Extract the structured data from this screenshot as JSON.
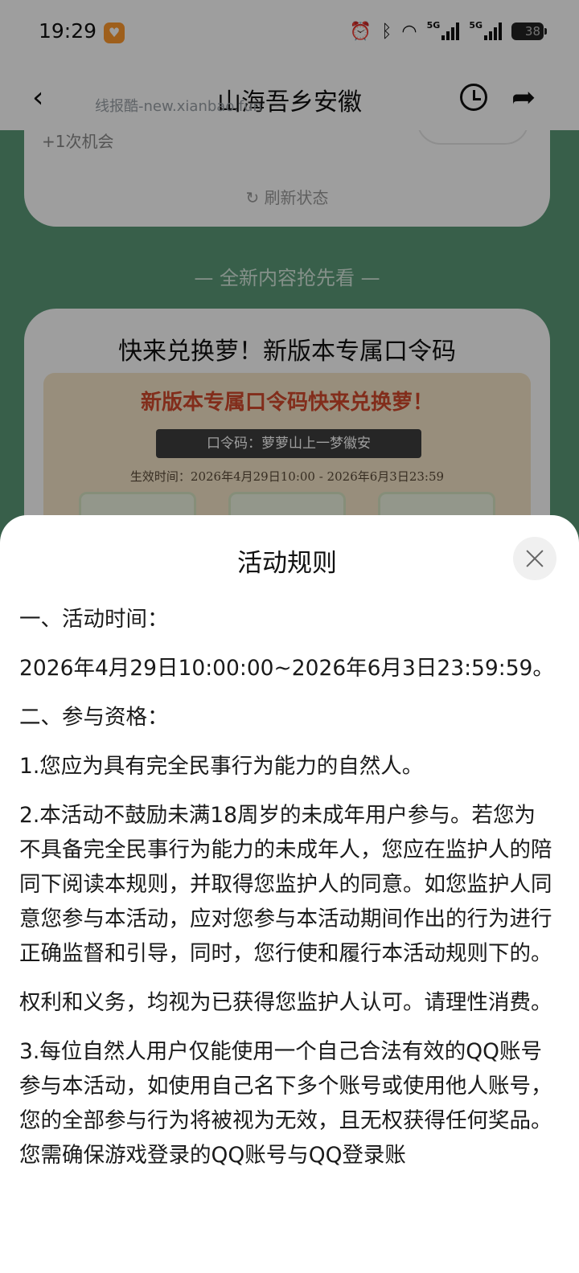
{
  "status_bar": {
    "time": "19:29",
    "app_badge_icon": "app-notification-icon",
    "network_type_1": "5G",
    "network_type_2": "5G",
    "battery_level": "38"
  },
  "nav": {
    "title": "山海吾乡安徽",
    "watermark": "线报酷-new.xianbao.fun"
  },
  "chance_card": {
    "chance_text": "+1次机会",
    "refresh_label": "刷新状态"
  },
  "section": {
    "divider_label": "— 全新内容抢先看 —"
  },
  "promo_card": {
    "title": "快来兑换萝！新版本专属口令码",
    "banner_title": "新版本专属口令码快来兑换萝！",
    "banner_code": "口令码：萝萝山上一梦徽安",
    "banner_time": "生效时间：2026年4月29日10:00 - 2026年6月3日23:59"
  },
  "rules_sheet": {
    "title": "活动规则",
    "paragraphs": [
      "一、活动时间：",
      "2026年4月29日10:00:00~2026年6月3日23:59:59。",
      "二、参与资格：",
      "1.您应为具有完全民事行为能力的自然人。",
      "2.本活动不鼓励未满18周岁的未成年用户参与。若您为不具备完全民事行为能力的未成年人，您应在监护人的陪同下阅读本规则，并取得您监护人的同意。如您监护人同意您参与本活动，应对您参与本活动期间作出的行为进行正确监督和引导，同时，您行使和履行本活动规则下的。",
      "权利和义务，均视为已获得您监护人认可。请理性消费。",
      "3.每位自然人用户仅能使用一个自己合法有效的QQ账号参与本活动，如使用自己名下多个账号或使用他人账号，您的全部参与行为将被视为无效，且无权获得任何奖品。您需确保游戏登录的QQ账号与QQ登录账"
    ]
  }
}
